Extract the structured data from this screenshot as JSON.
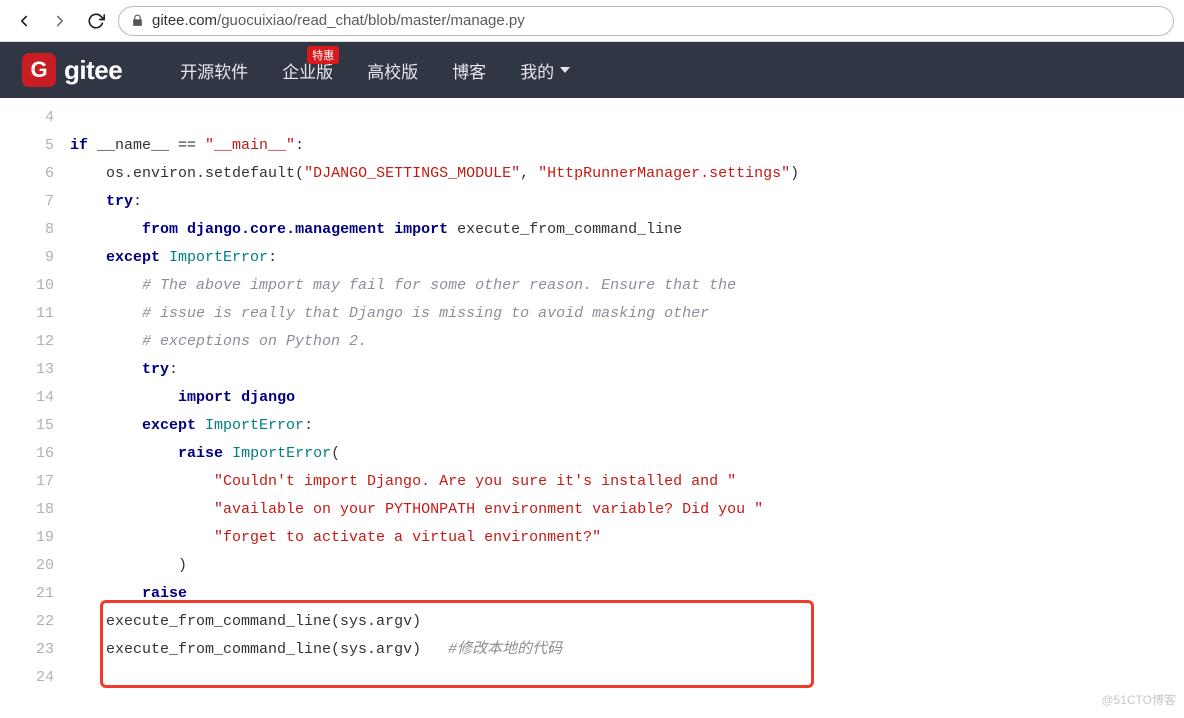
{
  "browser": {
    "url_host": "gitee.com",
    "url_path": "/guocuixiao/read_chat/blob/master/manage.py"
  },
  "header": {
    "logo_glyph": "G",
    "logo_text": "gitee",
    "nav_open_source": "开源软件",
    "nav_enterprise": "企业版",
    "nav_enterprise_badge": "特惠",
    "nav_university": "高校版",
    "nav_blog": "博客",
    "nav_mine": "我的"
  },
  "code": {
    "lines": [
      {
        "n": 4,
        "indent": 0,
        "segs": []
      },
      {
        "n": 5,
        "indent": 0,
        "segs": [
          {
            "t": "if",
            "c": "k"
          },
          {
            "t": " __name__ == ",
            "c": "op"
          },
          {
            "t": "\"__main__\"",
            "c": "s"
          },
          {
            "t": ":",
            "c": "op"
          }
        ]
      },
      {
        "n": 6,
        "indent": 1,
        "segs": [
          {
            "t": "os.environ.setdefault(",
            "c": "op"
          },
          {
            "t": "\"DJANGO_SETTINGS_MODULE\"",
            "c": "s"
          },
          {
            "t": ", ",
            "c": "op"
          },
          {
            "t": "\"HttpRunnerManager.settings\"",
            "c": "s"
          },
          {
            "t": ")",
            "c": "op"
          }
        ]
      },
      {
        "n": 7,
        "indent": 1,
        "segs": [
          {
            "t": "try",
            "c": "k"
          },
          {
            "t": ":",
            "c": "op"
          }
        ]
      },
      {
        "n": 8,
        "indent": 2,
        "segs": [
          {
            "t": "from",
            "c": "k"
          },
          {
            "t": " ",
            "c": "op"
          },
          {
            "t": "django.core.management",
            "c": "nn"
          },
          {
            "t": " ",
            "c": "op"
          },
          {
            "t": "import",
            "c": "k"
          },
          {
            "t": " execute_from_command_line",
            "c": "op"
          }
        ]
      },
      {
        "n": 9,
        "indent": 1,
        "segs": [
          {
            "t": "except",
            "c": "k"
          },
          {
            "t": " ",
            "c": "op"
          },
          {
            "t": "ImportError",
            "c": "nb"
          },
          {
            "t": ":",
            "c": "op"
          }
        ]
      },
      {
        "n": 10,
        "indent": 2,
        "segs": [
          {
            "t": "# The above import may fail for some other reason. Ensure that the",
            "c": "c1"
          }
        ]
      },
      {
        "n": 11,
        "indent": 2,
        "segs": [
          {
            "t": "# issue is really that Django is missing to avoid masking other",
            "c": "c1"
          }
        ]
      },
      {
        "n": 12,
        "indent": 2,
        "segs": [
          {
            "t": "# exceptions on Python 2.",
            "c": "c1"
          }
        ]
      },
      {
        "n": 13,
        "indent": 2,
        "segs": [
          {
            "t": "try",
            "c": "k"
          },
          {
            "t": ":",
            "c": "op"
          }
        ]
      },
      {
        "n": 14,
        "indent": 3,
        "segs": [
          {
            "t": "import",
            "c": "k"
          },
          {
            "t": " ",
            "c": "op"
          },
          {
            "t": "django",
            "c": "nn"
          }
        ]
      },
      {
        "n": 15,
        "indent": 2,
        "segs": [
          {
            "t": "except",
            "c": "k"
          },
          {
            "t": " ",
            "c": "op"
          },
          {
            "t": "ImportError",
            "c": "nb"
          },
          {
            "t": ":",
            "c": "op"
          }
        ]
      },
      {
        "n": 16,
        "indent": 3,
        "segs": [
          {
            "t": "raise",
            "c": "k"
          },
          {
            "t": " ",
            "c": "op"
          },
          {
            "t": "ImportError",
            "c": "nb"
          },
          {
            "t": "(",
            "c": "op"
          }
        ]
      },
      {
        "n": 17,
        "indent": 4,
        "segs": [
          {
            "t": "\"Couldn't import Django. Are you sure it's installed and \"",
            "c": "s"
          }
        ]
      },
      {
        "n": 18,
        "indent": 4,
        "segs": [
          {
            "t": "\"available on your PYTHONPATH environment variable? Did you \"",
            "c": "s"
          }
        ]
      },
      {
        "n": 19,
        "indent": 4,
        "segs": [
          {
            "t": "\"forget to activate a virtual environment?\"",
            "c": "s"
          }
        ]
      },
      {
        "n": 20,
        "indent": 3,
        "segs": [
          {
            "t": ")",
            "c": "op"
          }
        ]
      },
      {
        "n": 21,
        "indent": 2,
        "segs": [
          {
            "t": "raise",
            "c": "k"
          }
        ]
      },
      {
        "n": 22,
        "indent": 1,
        "segs": [
          {
            "t": "execute_from_command_line(sys.argv)",
            "c": "op"
          }
        ]
      },
      {
        "n": 23,
        "indent": 1,
        "segs": [
          {
            "t": "execute_from_command_line(sys.argv)   ",
            "c": "op"
          },
          {
            "t": "#修改本地的代码",
            "c": "c1"
          }
        ]
      },
      {
        "n": 24,
        "indent": 0,
        "segs": []
      }
    ],
    "highlight_start": 22,
    "highlight_end": 24
  },
  "watermark": "@51CTO博客"
}
